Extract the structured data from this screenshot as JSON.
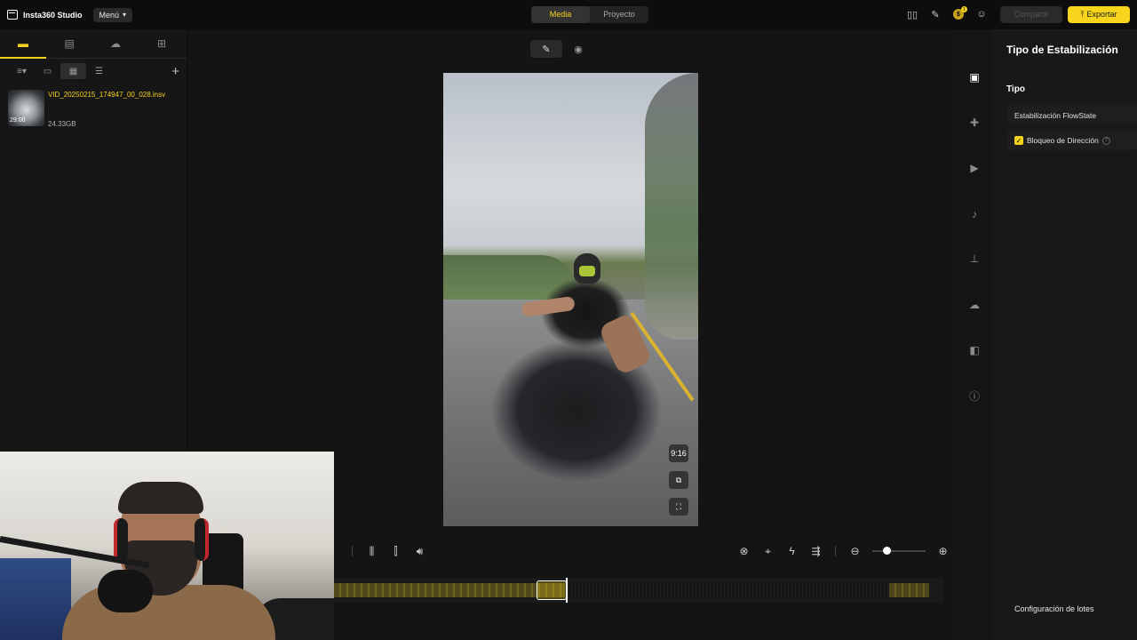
{
  "topbar": {
    "app_title": "Insta360 Studio",
    "menu_label": "Menú",
    "tabs": [
      {
        "label": "Media",
        "active": true
      },
      {
        "label": "Proyecto",
        "active": false
      }
    ],
    "coin_badge": "1",
    "share_label": "Compartir",
    "export_label": "Exportar",
    "accent_color": "#f7d51d"
  },
  "left_panel": {
    "tabs": [
      "media-icon",
      "file-icon",
      "cloud-icon",
      "import-icon"
    ],
    "files": [
      {
        "name": "VID_20250215_174947_00_028.insv",
        "size": "24.33GB",
        "duration": "29:00"
      }
    ]
  },
  "preview": {
    "tools": [
      "edit-icon",
      "eye-icon"
    ],
    "aspect_ratio": "9:16"
  },
  "right_panel": {
    "title": "Tipo de Estabilización",
    "section_label": "Tipo",
    "option": "Estabilización FlowState",
    "checkbox_label": "Bloqueo de Dirección",
    "checkbox_checked": true,
    "batch_label": "Configuración de lotes"
  },
  "rail_icons": [
    "stabilization-icon",
    "plugin-icon",
    "clip-icon",
    "audio-icon",
    "stamp-icon",
    "cloud-icon",
    "layers-icon",
    "info-icon"
  ]
}
